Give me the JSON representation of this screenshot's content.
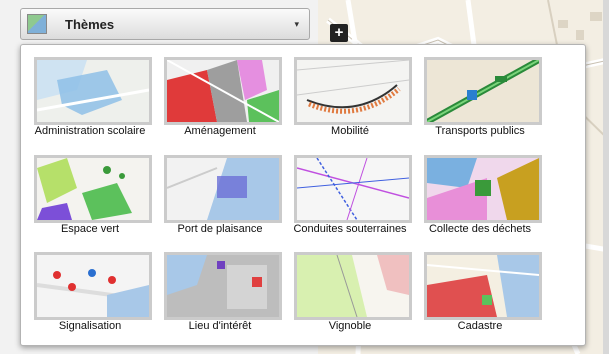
{
  "header": {
    "title": "Thèmes",
    "caret": "▾",
    "icon": "layers-thumbnail-icon"
  },
  "map": {
    "zoom_in_label": "+"
  },
  "themes": [
    {
      "label": "Administration scolaire"
    },
    {
      "label": "Aménagement"
    },
    {
      "label": "Mobilité"
    },
    {
      "label": "Transports publics"
    },
    {
      "label": "Espace vert"
    },
    {
      "label": "Port de plaisance"
    },
    {
      "label": "Conduites souterraines"
    },
    {
      "label": "Collecte des déchets"
    },
    {
      "label": "Signalisation"
    },
    {
      "label": "Lieu d'intérêt"
    },
    {
      "label": "Vignoble"
    },
    {
      "label": "Cadastre"
    }
  ],
  "colors": {
    "lake": "#a8c8e8",
    "map_bg": "#f3eee3",
    "accent_green": "#3a9a3a"
  }
}
